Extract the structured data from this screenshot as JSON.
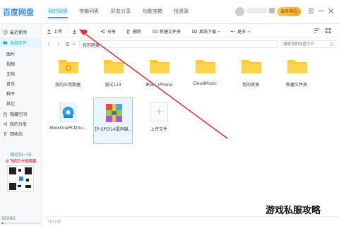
{
  "app": {
    "title": "百度网盘"
  },
  "top_tabs": [
    {
      "label": "我的网盘",
      "active": true
    },
    {
      "label": "传输列表",
      "active": false
    },
    {
      "label": "好友分享",
      "active": false
    },
    {
      "label": "功能宝箱",
      "active": false
    },
    {
      "label": "找资源",
      "active": false
    }
  ],
  "header": {
    "member_label": "会员中心"
  },
  "sidebar": {
    "items": [
      {
        "label": "最近使用",
        "icon": "clock-icon"
      },
      {
        "label": "全部文件",
        "icon": "folder-icon",
        "active": true
      },
      {
        "label": "图片",
        "sub": true
      },
      {
        "label": "视频",
        "sub": true
      },
      {
        "label": "文档",
        "sub": true
      },
      {
        "label": "音乐",
        "sub": true
      },
      {
        "label": "种子",
        "sub": true
      },
      {
        "label": "其它",
        "sub": true
      },
      {
        "label": "隐藏空间",
        "icon": "lock-icon"
      },
      {
        "label": "我的分享",
        "icon": "share-icon"
      },
      {
        "label": "回收站",
        "icon": "trash-icon"
      }
    ],
    "promo": {
      "title": "微信扫一扫",
      "subtitle": "小飞机打卡有惊喜"
    },
    "storage": {
      "text": "1029G"
    }
  },
  "toolbar": {
    "upload": "上传",
    "download": "下载",
    "share": "分享",
    "delete": "删除",
    "new_folder": "新建文件夹",
    "offline_download": "离线下载",
    "more": "更多"
  },
  "pathbar": {
    "crumb": "我的网盘",
    "search_placeholder": "搜索我的网盘文件"
  },
  "files": [
    {
      "name": "我的应用数据",
      "kind": "app-folder"
    },
    {
      "name": "测试123",
      "kind": "folder"
    },
    {
      "name": "来自：iPhone",
      "kind": "folder"
    },
    {
      "name": "CloudMusic",
      "kind": "folder"
    },
    {
      "name": "我的资源",
      "kind": "folder"
    },
    {
      "name": "新建文件夹",
      "kind": "folder"
    },
    {
      "name": "XboxOnePCDriv...",
      "kind": "installer"
    },
    {
      "name": "[P-SP]314雷声獣...",
      "kind": "archive",
      "selected": true
    },
    {
      "name": "上传文件",
      "kind": "upload"
    }
  ],
  "status": {
    "text": "共11项"
  },
  "watermark": "游戏私服攻略",
  "colors": {
    "accent": "#06a7ff",
    "folder": "#ffc933",
    "annotation_arrow": "#e8262b"
  }
}
